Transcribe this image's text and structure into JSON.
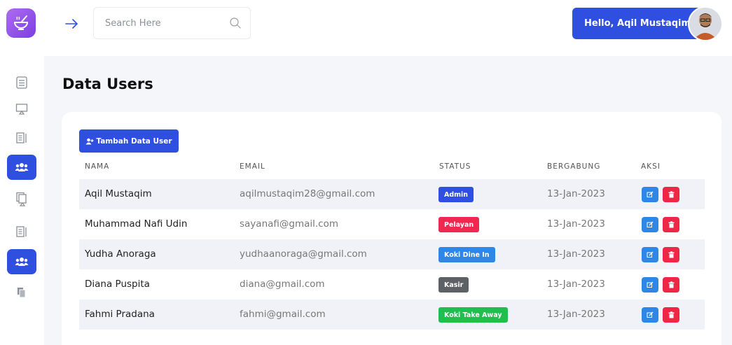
{
  "topbar": {
    "search_placeholder": "Search Here",
    "greeting": "Hello, Aqil Mustaqim"
  },
  "sidebar": {
    "items": [
      {
        "icon": "dashboard-icon",
        "active": false
      },
      {
        "icon": "monitor-icon",
        "active": false
      },
      {
        "icon": "report-icon",
        "active": false
      },
      {
        "icon": "users-icon",
        "active": true
      },
      {
        "icon": "documents-icon",
        "active": false
      },
      {
        "icon": "report-icon",
        "active": false
      },
      {
        "icon": "users-icon",
        "active": true
      },
      {
        "icon": "copy-icon",
        "active": false
      }
    ]
  },
  "page": {
    "title": "Data Users",
    "add_button_label": "Tambah Data User"
  },
  "table": {
    "columns": [
      "NAMA",
      "EMAIL",
      "STATUS",
      "BERGABUNG",
      "AKSI"
    ],
    "rows": [
      {
        "name": "Aqil Mustaqim",
        "email": "aqilmustaqim28@gmail.com",
        "status": "Admin",
        "status_color": "#2e4fe0",
        "joined": "13-Jan-2023"
      },
      {
        "name": "Muhammad Nafi Udin",
        "email": "sayanafi@gmail.com",
        "status": "Pelayan",
        "status_color": "#f0274e",
        "joined": "13-Jan-2023"
      },
      {
        "name": "Yudha Anoraga",
        "email": "yudhaanoraga@gmail.com",
        "status": "Koki Dine In",
        "status_color": "#2e87e6",
        "joined": "13-Jan-2023"
      },
      {
        "name": "Diana Puspita",
        "email": "diana@gmail.com",
        "status": "Kasir",
        "status_color": "#5d6166",
        "joined": "13-Jan-2023"
      },
      {
        "name": "Fahmi Pradana",
        "email": "fahmi@gmail.com",
        "status": "Koki Take Away",
        "status_color": "#1fbe4f",
        "joined": "13-Jan-2023"
      }
    ]
  },
  "colors": {
    "primary": "#2e4fe0",
    "edit": "#2e87e6",
    "delete": "#ef2747"
  }
}
